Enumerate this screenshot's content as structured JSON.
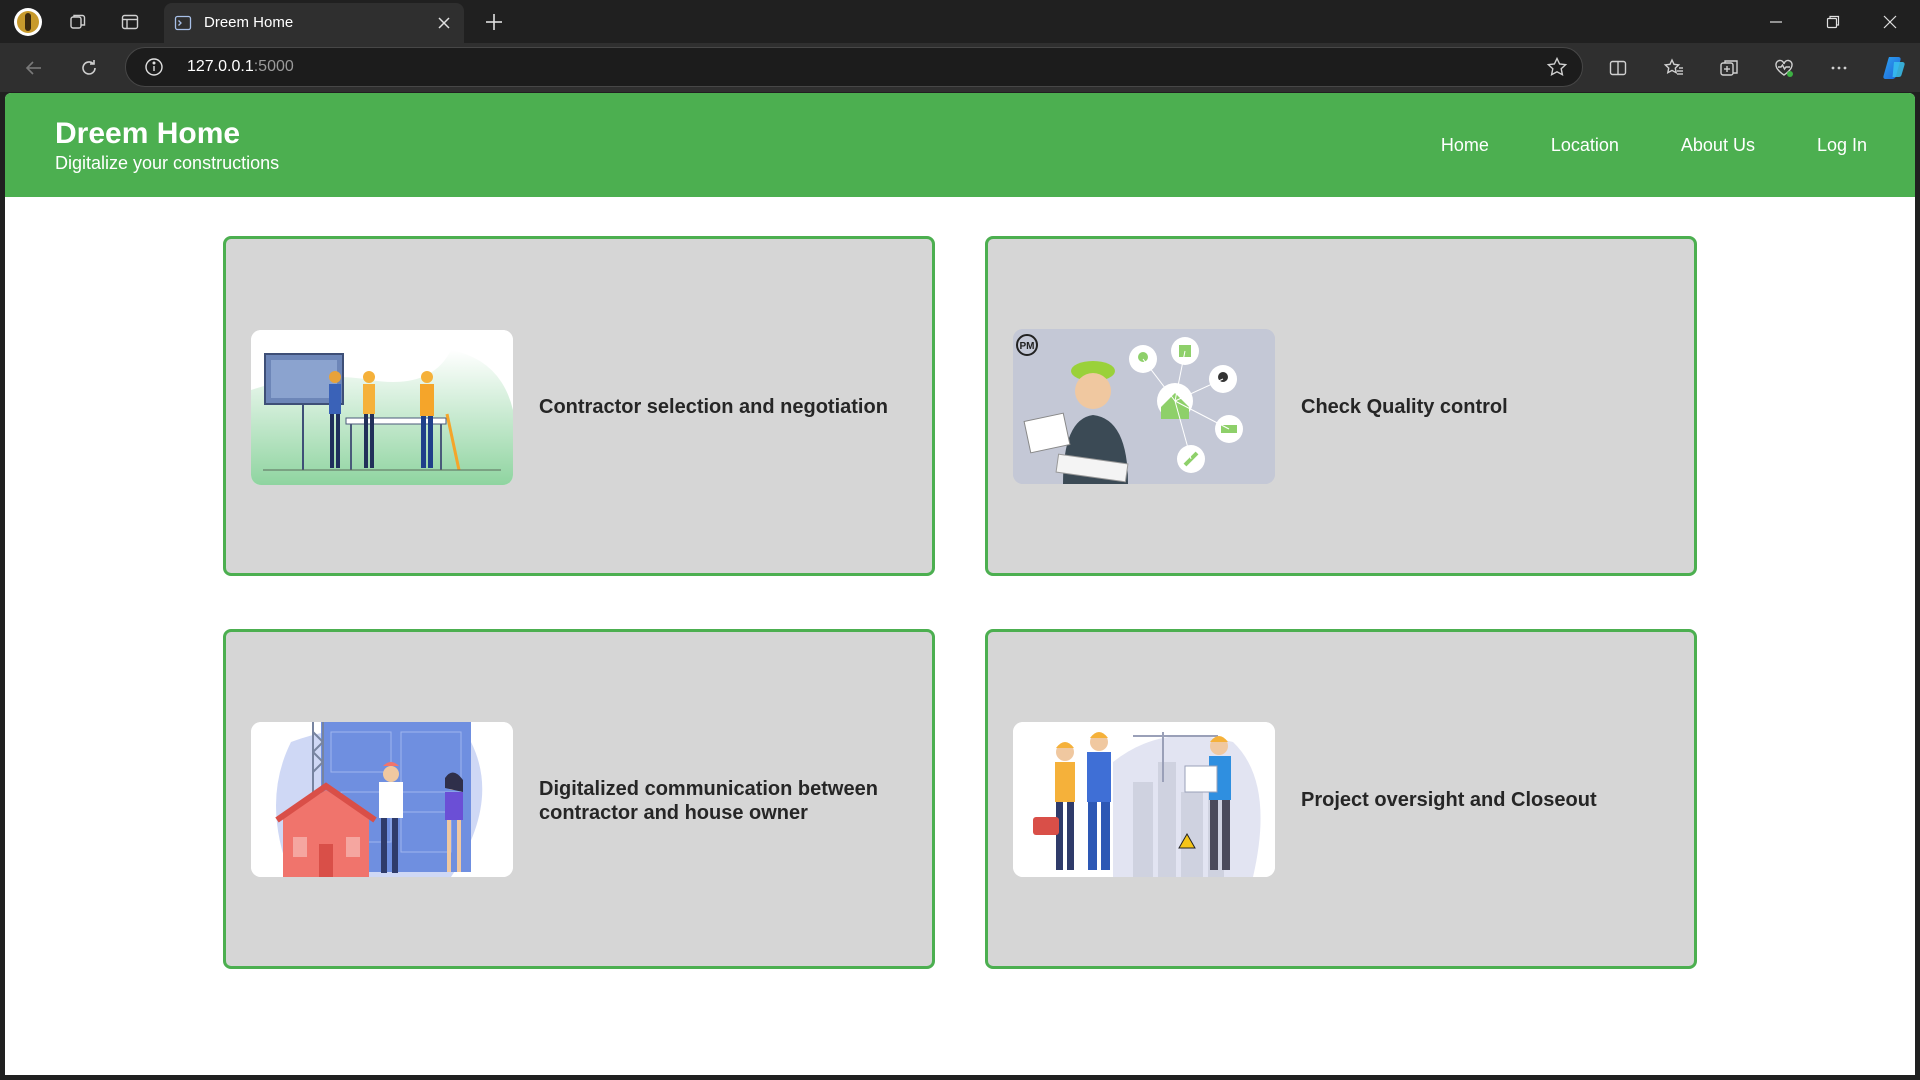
{
  "browser": {
    "tab_title": "Dreem Home",
    "url_host": "127.0.0.1",
    "url_port": ":5000"
  },
  "site": {
    "title": "Dreem Home",
    "tagline": "Digitalize your constructions",
    "nav": [
      "Home",
      "Location",
      "About Us",
      "Log In"
    ]
  },
  "cards": [
    {
      "label": "Contractor selection and negotiation",
      "image": "contractors-meeting-illustration"
    },
    {
      "label": "Check Quality control",
      "image": "project-manager-illustration"
    },
    {
      "label": "Digitalized communication between contractor and house owner",
      "image": "house-blueprint-illustration"
    },
    {
      "label": "Project oversight and Closeout",
      "image": "construction-team-illustration"
    }
  ],
  "colors": {
    "header_green": "#4caf50",
    "card_bg": "#d6d6d6",
    "chrome_dark": "#202020",
    "chrome_toolbar": "#2f2f2f"
  }
}
